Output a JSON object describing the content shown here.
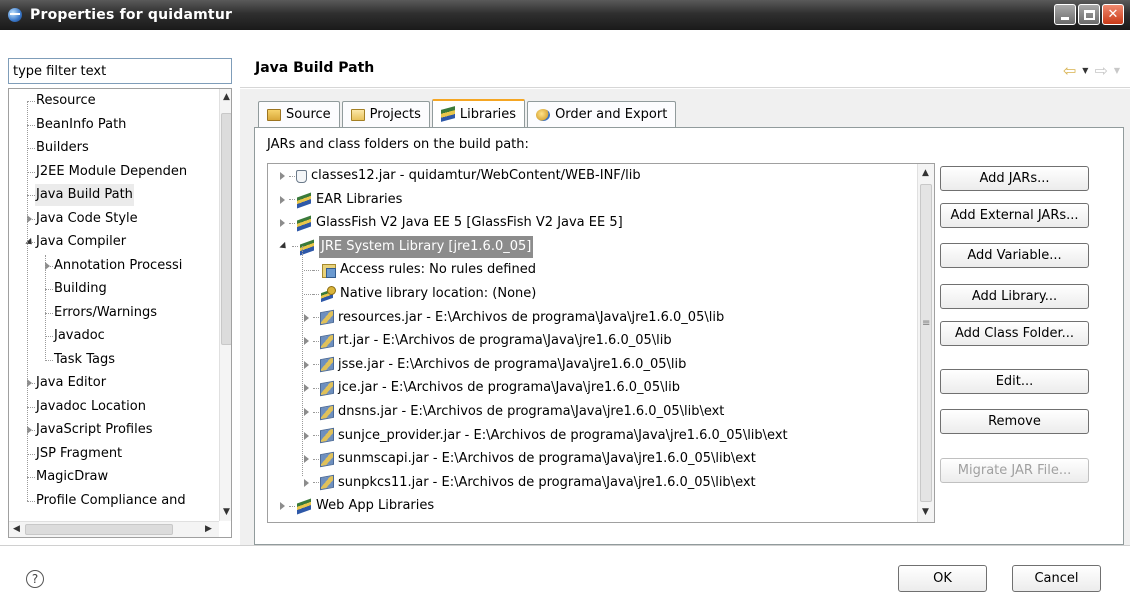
{
  "window": {
    "title": "Properties for quidamtur"
  },
  "filter": {
    "value": "type filter text"
  },
  "nav_tree": [
    {
      "label": "Resource",
      "level": 0,
      "expander": "none",
      "selected": false
    },
    {
      "label": "BeanInfo Path",
      "level": 0,
      "expander": "none",
      "selected": false
    },
    {
      "label": "Builders",
      "level": 0,
      "expander": "none",
      "selected": false
    },
    {
      "label": "J2EE Module Dependen",
      "level": 0,
      "expander": "none",
      "selected": false
    },
    {
      "label": "Java Build Path",
      "level": 0,
      "expander": "none",
      "selected": true
    },
    {
      "label": "Java Code Style",
      "level": 0,
      "expander": "collapsed",
      "selected": false
    },
    {
      "label": "Java Compiler",
      "level": 0,
      "expander": "expanded",
      "selected": false
    },
    {
      "label": "Annotation Processi",
      "level": 1,
      "expander": "collapsed",
      "selected": false
    },
    {
      "label": "Building",
      "level": 1,
      "expander": "none",
      "selected": false
    },
    {
      "label": "Errors/Warnings",
      "level": 1,
      "expander": "none",
      "selected": false
    },
    {
      "label": "Javadoc",
      "level": 1,
      "expander": "none",
      "selected": false
    },
    {
      "label": "Task Tags",
      "level": 1,
      "expander": "none",
      "selected": false
    },
    {
      "label": "Java Editor",
      "level": 0,
      "expander": "collapsed",
      "selected": false
    },
    {
      "label": "Javadoc Location",
      "level": 0,
      "expander": "none",
      "selected": false
    },
    {
      "label": "JavaScript Profiles",
      "level": 0,
      "expander": "collapsed",
      "selected": false
    },
    {
      "label": "JSP Fragment",
      "level": 0,
      "expander": "none",
      "selected": false
    },
    {
      "label": "MagicDraw",
      "level": 0,
      "expander": "none",
      "selected": false
    },
    {
      "label": "Profile Compliance and",
      "level": 0,
      "expander": "none",
      "selected": false
    }
  ],
  "page": {
    "title": "Java Build Path"
  },
  "tabs": [
    {
      "label": "Source",
      "icon": "source-folder-icon",
      "active": false
    },
    {
      "label": "Projects",
      "icon": "projects-folder-icon",
      "active": false
    },
    {
      "label": "Libraries",
      "icon": "libraries-icon",
      "active": true
    },
    {
      "label": "Order and Export",
      "icon": "order-export-icon",
      "active": false
    }
  ],
  "libraries": {
    "heading": "JARs and class folders on the build path:",
    "items": [
      {
        "label": "classes12.jar - quidamtur/WebContent/WEB-INF/lib",
        "level": 0,
        "expander": "collapsed",
        "icon": "jar-file-icon",
        "selected": false
      },
      {
        "label": "EAR Libraries",
        "level": 0,
        "expander": "collapsed",
        "icon": "library-icon",
        "selected": false
      },
      {
        "label": "GlassFish V2 Java EE 5 [GlassFish V2 Java EE 5]",
        "level": 0,
        "expander": "collapsed",
        "icon": "library-icon",
        "selected": false
      },
      {
        "label": "JRE System Library [jre1.6.0_05]",
        "level": 0,
        "expander": "expanded",
        "icon": "library-icon",
        "selected": true
      },
      {
        "label": "Access rules: No rules defined",
        "level": 1,
        "expander": "none",
        "icon": "access-rules-icon",
        "selected": false
      },
      {
        "label": "Native library location: (None)",
        "level": 1,
        "expander": "none",
        "icon": "native-library-icon",
        "selected": false
      },
      {
        "label": "resources.jar - E:\\Archivos de programa\\Java\\jre1.6.0_05\\lib",
        "level": 1,
        "expander": "collapsed",
        "icon": "jar-icon",
        "selected": false
      },
      {
        "label": "rt.jar - E:\\Archivos de programa\\Java\\jre1.6.0_05\\lib",
        "level": 1,
        "expander": "collapsed",
        "icon": "jar-icon",
        "selected": false
      },
      {
        "label": "jsse.jar - E:\\Archivos de programa\\Java\\jre1.6.0_05\\lib",
        "level": 1,
        "expander": "collapsed",
        "icon": "jar-icon",
        "selected": false
      },
      {
        "label": "jce.jar - E:\\Archivos de programa\\Java\\jre1.6.0_05\\lib",
        "level": 1,
        "expander": "collapsed",
        "icon": "jar-icon",
        "selected": false
      },
      {
        "label": "dnsns.jar - E:\\Archivos de programa\\Java\\jre1.6.0_05\\lib\\ext",
        "level": 1,
        "expander": "collapsed",
        "icon": "jar-icon",
        "selected": false
      },
      {
        "label": "sunjce_provider.jar - E:\\Archivos de programa\\Java\\jre1.6.0_05\\lib\\ext",
        "level": 1,
        "expander": "collapsed",
        "icon": "jar-icon",
        "selected": false
      },
      {
        "label": "sunmscapi.jar - E:\\Archivos de programa\\Java\\jre1.6.0_05\\lib\\ext",
        "level": 1,
        "expander": "collapsed",
        "icon": "jar-icon",
        "selected": false
      },
      {
        "label": "sunpkcs11.jar - E:\\Archivos de programa\\Java\\jre1.6.0_05\\lib\\ext",
        "level": 1,
        "expander": "collapsed",
        "icon": "jar-icon",
        "selected": false
      },
      {
        "label": "Web App Libraries",
        "level": 0,
        "expander": "collapsed",
        "icon": "library-icon",
        "selected": false
      }
    ]
  },
  "buttons": [
    {
      "label": "Add JARs...",
      "enabled": true,
      "name": "add-jars-button"
    },
    {
      "label": "Add External JARs...",
      "enabled": true,
      "name": "add-external-jars-button"
    },
    {
      "label": "Add Variable...",
      "enabled": true,
      "name": "add-variable-button"
    },
    {
      "label": "Add Library...",
      "enabled": true,
      "name": "add-library-button"
    },
    {
      "label": "Add Class Folder...",
      "enabled": true,
      "name": "add-class-folder-button"
    },
    {
      "label": "Edit...",
      "enabled": true,
      "name": "edit-button"
    },
    {
      "label": "Remove",
      "enabled": true,
      "name": "remove-button"
    },
    {
      "label": "Migrate JAR File...",
      "enabled": false,
      "name": "migrate-jar-button"
    }
  ],
  "footer": {
    "ok_label": "OK",
    "cancel_label": "Cancel"
  },
  "colors": {
    "title_bar": "#2f2f2f",
    "selection_gray": "#8c8c8c",
    "active_tab_accent": "#f5a623",
    "nav_arrow": "#d8b250"
  }
}
